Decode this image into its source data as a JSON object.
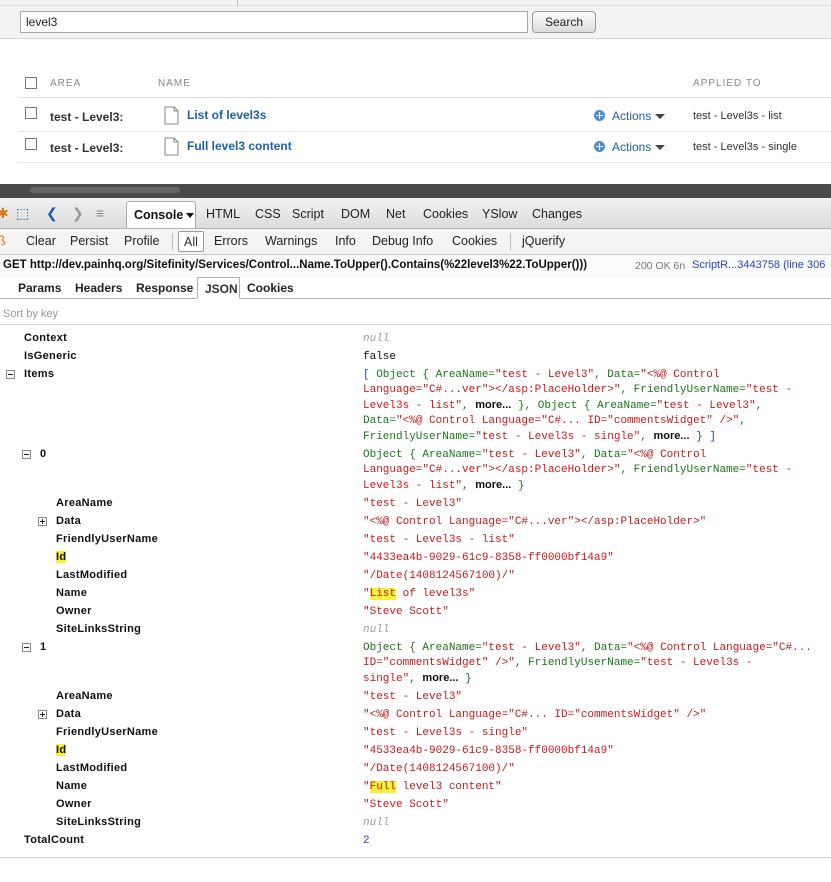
{
  "search": {
    "value": "level3",
    "button": "Search"
  },
  "grid": {
    "headers": {
      "area": "AREA",
      "name": "NAME",
      "applied": "APPLIED TO"
    },
    "rows": [
      {
        "area": "test - Level3:",
        "name": "List of level3s",
        "actions": "Actions",
        "applied": "test - Level3s - list"
      },
      {
        "area": "test - Level3:",
        "name": "Full level3 content",
        "actions": "Actions",
        "applied": "test - Level3s - single"
      }
    ]
  },
  "firebug": {
    "tabs": [
      "Console",
      "HTML",
      "CSS",
      "Script",
      "DOM",
      "Net",
      "Cookies",
      "YSlow",
      "Changes"
    ],
    "subbar": [
      "Clear",
      "Persist",
      "Profile",
      "All",
      "Errors",
      "Warnings",
      "Info",
      "Debug Info",
      "Cookies",
      "jQuerify"
    ],
    "request": {
      "url": "GET http://dev.painhq.org/Sitefinity/Services/Control...Name.ToUpper().Contains(%22level3%22.ToUpper()))",
      "status": "200 OK 6n",
      "script": "ScriptR...3443758 (line 306"
    },
    "req_tabs": [
      "Params",
      "Headers",
      "Response",
      "JSON",
      "Cookies"
    ],
    "sort_label": "Sort by key"
  },
  "json": {
    "context_key": "Context",
    "context_val": "null",
    "isgeneric_key": "IsGeneric",
    "isgeneric_val": "false",
    "items_key": "Items",
    "items_summary": {
      "l1a": "[ ",
      "l1b": "Object",
      "l1c": " { AreaName=",
      "l1d": "\"test - Level3\"",
      "l1e": ", Data=",
      "l1f": "\"<%@ Control",
      "l2a": "Language=\"C#...ver\"></asp:PlaceHolder>\"",
      "l2b": ", FriendlyUserName=",
      "l2c": "\"test -",
      "l3a": "Level3s - list\"",
      "l3b": ", ",
      "l3c": "more...",
      "l3d": " }, ",
      "l3e": "Object",
      "l3f": " { AreaName=",
      "l3g": "\"test - Level3\"",
      "l3h": ",",
      "l4a": "Data=",
      "l4b": "\"<%@ Control Language=\"C#... ID=\"commentsWidget\" />\"",
      "l4c": ",",
      "l5a": "FriendlyUserName=",
      "l5b": "\"test - Level3s - single\"",
      "l5c": ", ",
      "l5d": "more...",
      "l5e": " } ]"
    },
    "item0": {
      "key": "0",
      "summary": {
        "l1a": "Object",
        "l1b": " { AreaName=",
        "l1c": "\"test - Level3\"",
        "l1d": ", Data=",
        "l1e": "\"<%@ Control",
        "l2a": "Language=\"C#...ver\"></asp:PlaceHolder>\"",
        "l2b": ", FriendlyUserName=",
        "l2c": "\"test -",
        "l3a": "Level3s - list\"",
        "l3b": ", ",
        "l3c": "more...",
        "l3d": " }"
      },
      "areaname": "\"test - Level3\"",
      "data": "\"<%@ Control Language=\"C#...ver\"></asp:PlaceHolder>\"",
      "friendly": "\"test - Level3s - list\"",
      "id": "\"4433ea4b-9029-61c9-8358-ff0000bf14a9\"",
      "lastmod": "\"/Date(1408124567100)/\"",
      "name_q": "\"",
      "name_hl": "List",
      "name_rest": " of level3s\"",
      "owner": "\"Steve Scott\"",
      "sitelinks": "null"
    },
    "item1": {
      "key": "1",
      "summary": {
        "l1a": "Object",
        "l1b": " { AreaName=",
        "l1c": "\"test - Level3\"",
        "l1d": ", Data=",
        "l1e": "\"<%@ Control Language=\"C#...",
        "l2a": "ID=\"commentsWidget\" />\"",
        "l2b": ", FriendlyUserName=",
        "l2c": "\"test - Level3s -",
        "l3a": "single\"",
        "l3b": ", ",
        "l3c": "more...",
        "l3d": " }"
      },
      "areaname": "\"test - Level3\"",
      "data": "\"<%@ Control Language=\"C#... ID=\"commentsWidget\" />\"",
      "friendly": "\"test - Level3s - single\"",
      "id": "\"4533ea4b-9029-61c9-8358-ff0000bf14a9\"",
      "lastmod": "\"/Date(1408124567100)/\"",
      "name_q": "\"",
      "name_hl": "Full",
      "name_rest": " level3 content\"",
      "owner": "\"Steve Scott\"",
      "sitelinks": "null"
    },
    "keys": {
      "areaname": "AreaName",
      "data": "Data",
      "friendly": "FriendlyUserName",
      "id": "Id",
      "lastmod": "LastModified",
      "name": "Name",
      "owner": "Owner",
      "sitelinks": "SiteLinksString"
    },
    "totalcount_key": "TotalCount",
    "totalcount_val": "2"
  }
}
